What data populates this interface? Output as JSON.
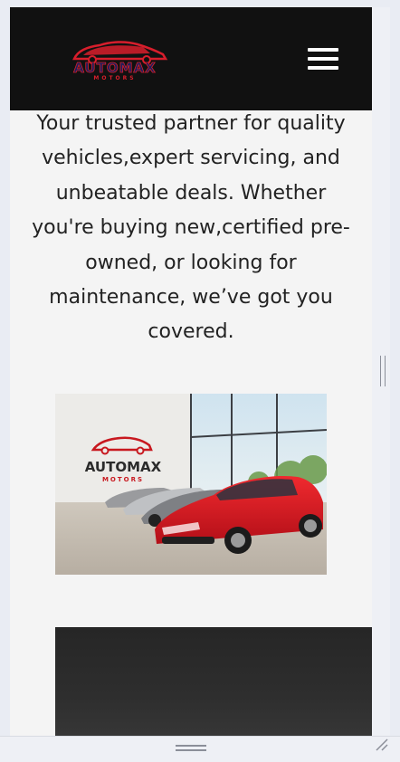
{
  "brand": {
    "logo_word": "AUTOMAX",
    "logo_subword": "MOTORS",
    "logo_color": "#d81e2c"
  },
  "nav": {
    "menu_icon": "hamburger-menu-icon"
  },
  "intro": {
    "text": "Your trusted partner for quality vehicles,expert servicing, and unbeatable deals. Whether you're buying new,certified pre-owned, or looking for maintenance, we’ve got you covered."
  },
  "showroom": {
    "sign_word": "AUTOMAX",
    "sign_subword": "MOTORS",
    "car_color": "#e0151f"
  }
}
